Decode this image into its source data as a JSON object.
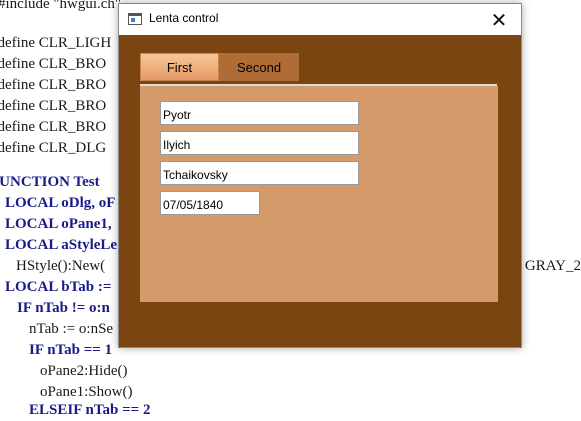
{
  "editor": {
    "lines": [
      "#include \"hwgui.ch\"",
      "#define CLR_LIGH",
      "#define CLR_BRO",
      "#define CLR_BRO",
      "#define CLR_BRO",
      "#define CLR_BRO",
      "#define CLR_DLG",
      "FUNCTION Test",
      "LOCAL oDlg, oF",
      "LOCAL oPane1,",
      "LOCAL aStyleLe",
      "HStyle():New(",
      "LOCAL bTab :=",
      "IF nTab != o:n",
      "nTab := o:nSe",
      "IF nTab == 1",
      "oPane2:Hide()",
      "oPane1:Show()",
      "ELSEIF nTab == 2"
    ],
    "right_fragment": "GRAY_2"
  },
  "window": {
    "title": "Lenta control",
    "close_symbol": "✕"
  },
  "tabs": [
    {
      "label": "First",
      "active": true
    },
    {
      "label": "Second",
      "active": false
    }
  ],
  "fields": {
    "first_name": "Pyotr",
    "middle_name": "Ilyich",
    "last_name": "Tchaikovsky",
    "date": "07/05/1840"
  },
  "colors": {
    "window_bg": "#7a4511",
    "panel_bg": "#d59a6a",
    "tab_active": "#e59a66",
    "tab_inactive": "#b06c36",
    "keyword": "#1a1a8a"
  }
}
